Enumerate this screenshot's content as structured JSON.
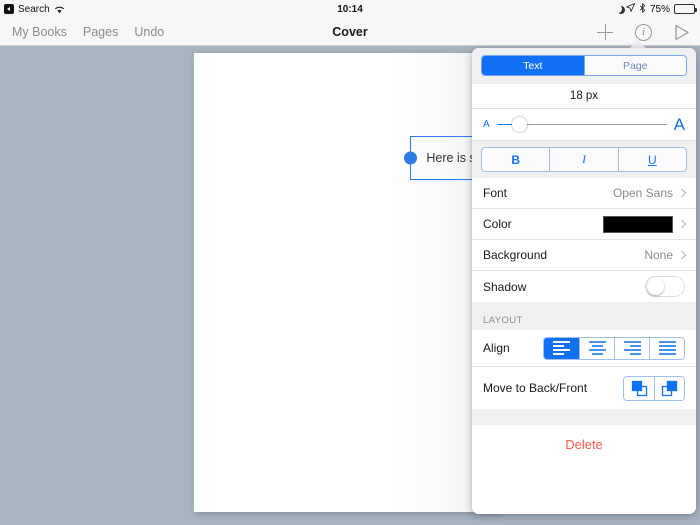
{
  "statusbar": {
    "back_label": "Search",
    "wifi_icon": "wifi-icon",
    "time": "10:14",
    "moon_icon": "moon-icon",
    "location_icon": "location-arrow-icon",
    "bluetooth_icon": "bluetooth-icon",
    "battery_percent": "75%",
    "battery_icon": "battery-icon",
    "battery_level": 75
  },
  "navbar": {
    "my_books": "My Books",
    "pages": "Pages",
    "undo": "Undo",
    "title": "Cover",
    "add_icon": "plus-icon",
    "info_icon": "info-circle-icon",
    "info_glyph": "i",
    "preview_icon": "play-triangle-icon"
  },
  "canvas": {
    "textbox": {
      "text": "Here is some text",
      "handle_left": "resize-handle-left",
      "handle_right": "resize-handle-right"
    }
  },
  "panel": {
    "segments": [
      {
        "label": "Text",
        "active": true
      },
      {
        "label": "Page",
        "active": false
      }
    ],
    "font_size": "18 px",
    "slider": {
      "min_label": "A",
      "max_label": "A",
      "value_percent": 13
    },
    "style_buttons": [
      {
        "label": "B",
        "name": "bold-button"
      },
      {
        "label": "I",
        "name": "italic-button"
      },
      {
        "label": "U",
        "name": "underline-button"
      }
    ],
    "rows": [
      {
        "label": "Font",
        "value": "Open Sans",
        "type": "chevron"
      },
      {
        "label": "Color",
        "value": "",
        "type": "swatch",
        "color": "#000000"
      },
      {
        "label": "Background",
        "value": "None",
        "type": "chevron"
      },
      {
        "label": "Shadow",
        "value": "",
        "type": "toggle",
        "on": false
      }
    ],
    "layout_section": "LAYOUT",
    "align": {
      "label": "Align",
      "options": [
        {
          "name": "align-left-button",
          "active": true
        },
        {
          "name": "align-center-button",
          "active": false
        },
        {
          "name": "align-right-button",
          "active": false
        },
        {
          "name": "align-justify-button",
          "active": false
        }
      ]
    },
    "move": {
      "label": "Move to Back/Front",
      "back_icon": "send-to-back-icon",
      "front_icon": "bring-to-front-icon"
    },
    "delete_label": "Delete",
    "accent_color": "#1171f5",
    "delete_color": "#fa5b4c"
  }
}
